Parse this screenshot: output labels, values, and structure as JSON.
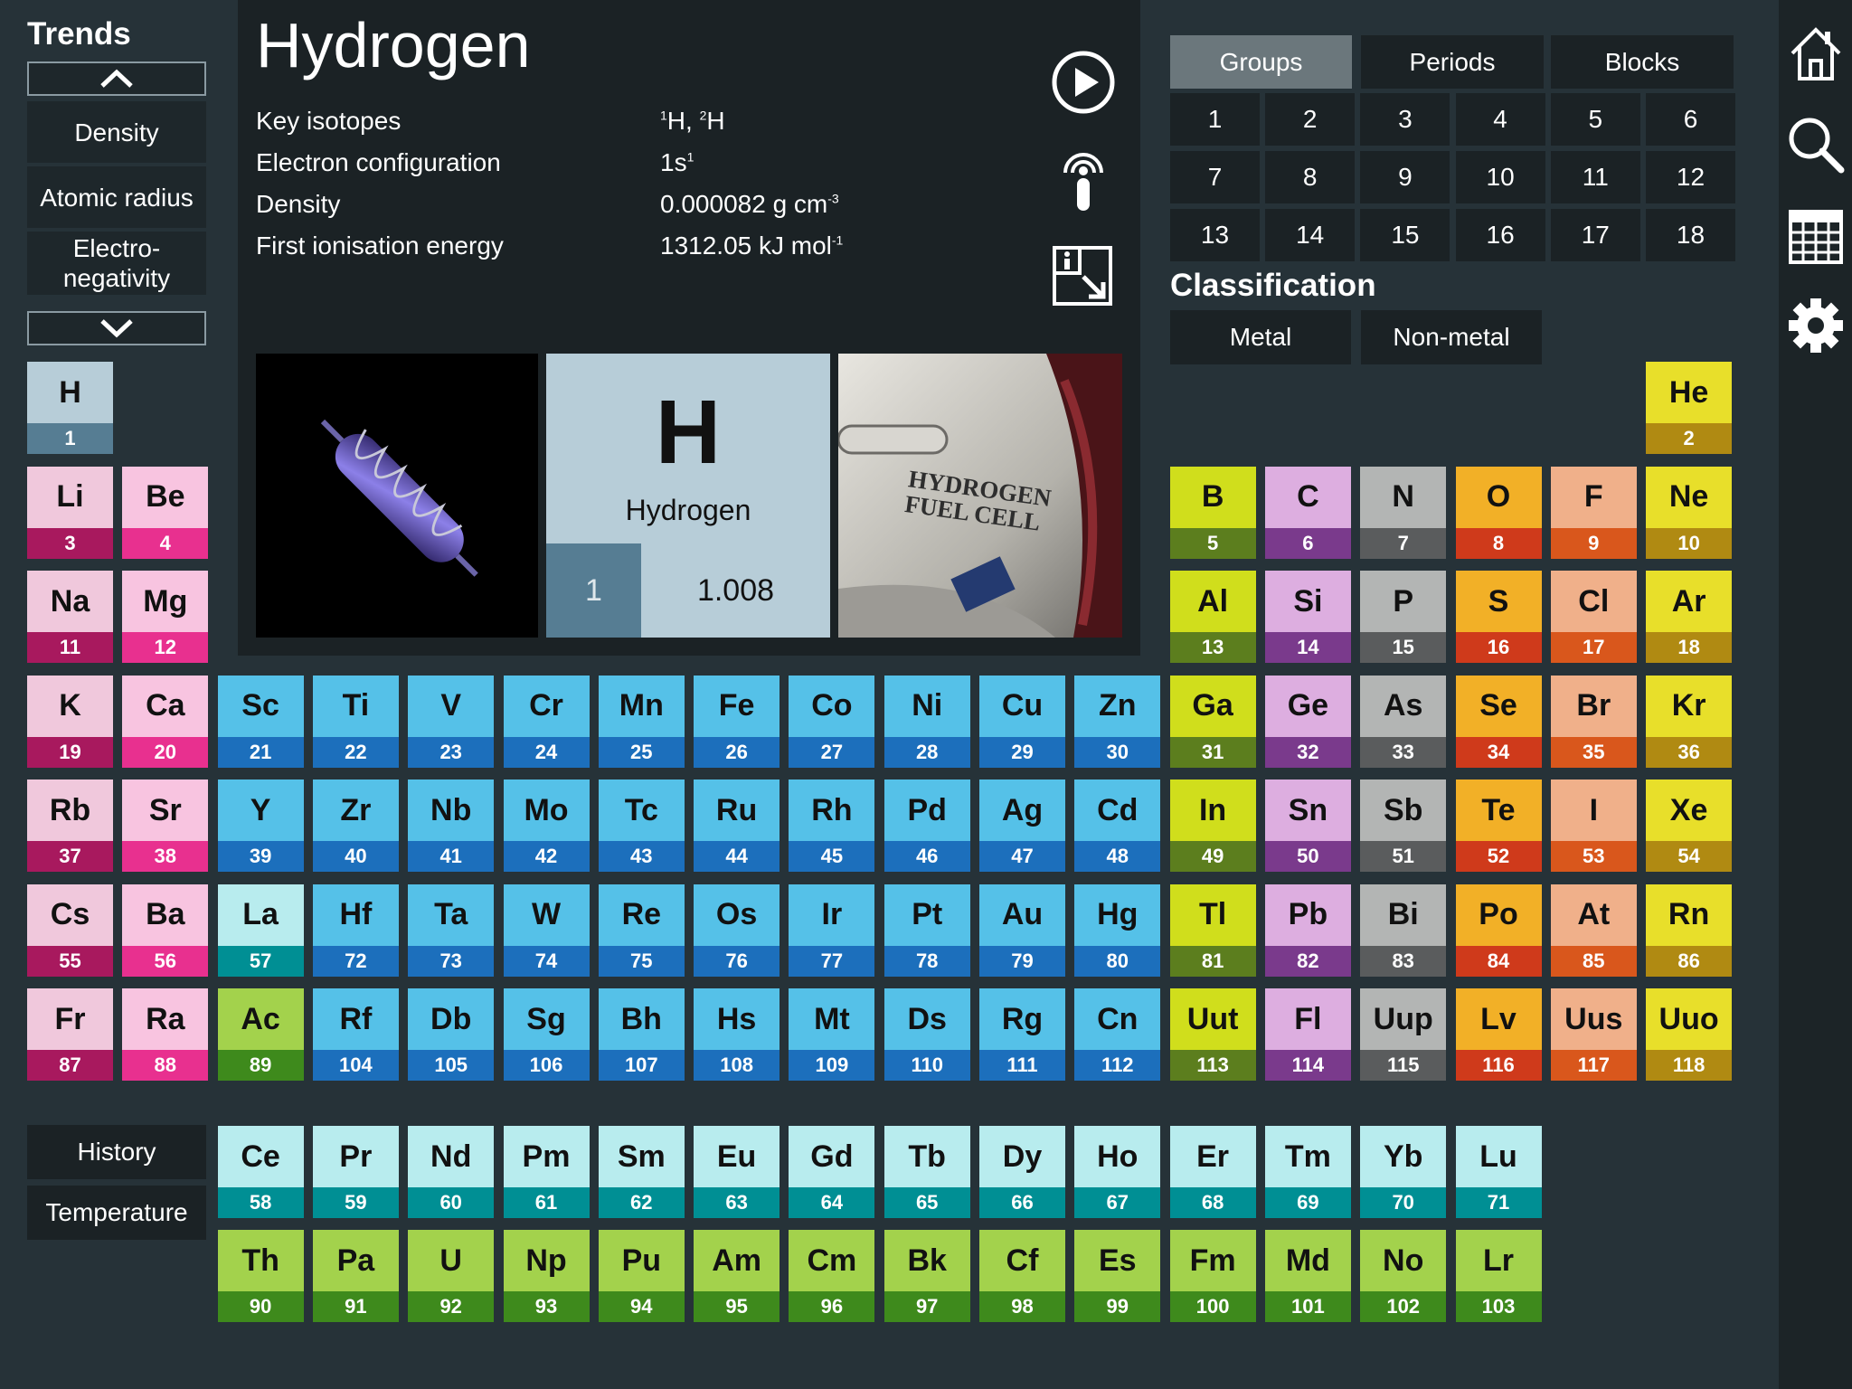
{
  "trends": {
    "title": "Trends",
    "items": [
      "Density",
      "Atomic radius",
      "Electro-\nnegativity"
    ]
  },
  "element": {
    "name": "Hydrogen",
    "symbol": "H",
    "number": "1",
    "mass": "1.008",
    "properties": [
      {
        "label": "Key isotopes",
        "value": [
          {
            "t": "1",
            "sup": true
          },
          {
            "t": "H, "
          },
          {
            "t": "2",
            "sup": true
          },
          {
            "t": "H"
          }
        ]
      },
      {
        "label": "Electron configuration",
        "value": [
          {
            "t": "1s"
          },
          {
            "t": "1",
            "sup": true
          }
        ]
      },
      {
        "label": "Density",
        "value": [
          {
            "t": "0.000082 g cm"
          },
          {
            "t": "-3",
            "sup": true
          }
        ]
      },
      {
        "label": "First ionisation energy",
        "value": [
          {
            "t": "1312.05 kJ mol"
          },
          {
            "t": "-1",
            "sup": true
          }
        ]
      }
    ],
    "photo_label": "HYDROGEN\nFUEL CELL"
  },
  "filters": {
    "tabs": [
      "Groups",
      "Periods",
      "Blocks"
    ],
    "active_tab": "Groups",
    "groups": [
      "1",
      "2",
      "3",
      "4",
      "5",
      "6",
      "7",
      "8",
      "9",
      "10",
      "11",
      "12",
      "13",
      "14",
      "15",
      "16",
      "17",
      "18"
    ],
    "classification_title": "Classification",
    "classification": [
      "Metal",
      "Non-metal"
    ]
  },
  "bottom_buttons": [
    "History",
    "Temperature"
  ],
  "sidebar_icons": [
    "home-icon",
    "search-icon",
    "table-icon",
    "gear-icon"
  ],
  "colors": {
    "alkali": {
      "top": "#f0c8dc",
      "bot": "#a8195e"
    },
    "alkaline": {
      "top": "#f8c4e0",
      "bot": "#e8308f"
    },
    "hydrogen": {
      "top": "#b7cdd8",
      "bot": "#567d93"
    },
    "transition": {
      "top": "#55c1e8",
      "bot": "#1c6fbc"
    },
    "lanthanide": {
      "top": "#b8ecee",
      "bot": "#008f94"
    },
    "actinide": {
      "top": "#a3d24c",
      "bot": "#3e8a1c"
    },
    "post": {
      "top": "#d0de1c",
      "bot": "#5c7e1e"
    },
    "metalloid": {
      "top": "#ddaee0",
      "bot": "#7a3a8c"
    },
    "nonmetal": {
      "top": "#b3b5b4",
      "bot": "#5a5c5d"
    },
    "chalcogen": {
      "top": "#f2b027",
      "bot": "#cf3a1b"
    },
    "halogen": {
      "top": "#f0b08a",
      "bot": "#d9571c"
    },
    "noble": {
      "top": "#e8df2a",
      "bot": "#b08a12"
    }
  },
  "elements": [
    {
      "s": "H",
      "n": 1,
      "c": "hydrogen"
    },
    {
      "s": "He",
      "n": 2,
      "c": "noble"
    },
    {
      "s": "Li",
      "n": 3,
      "c": "alkali"
    },
    {
      "s": "Be",
      "n": 4,
      "c": "alkaline"
    },
    {
      "s": "B",
      "n": 5,
      "c": "post"
    },
    {
      "s": "C",
      "n": 6,
      "c": "metalloid"
    },
    {
      "s": "N",
      "n": 7,
      "c": "nonmetal"
    },
    {
      "s": "O",
      "n": 8,
      "c": "chalcogen"
    },
    {
      "s": "F",
      "n": 9,
      "c": "halogen"
    },
    {
      "s": "Ne",
      "n": 10,
      "c": "noble"
    },
    {
      "s": "Na",
      "n": 11,
      "c": "alkali"
    },
    {
      "s": "Mg",
      "n": 12,
      "c": "alkaline"
    },
    {
      "s": "Al",
      "n": 13,
      "c": "post"
    },
    {
      "s": "Si",
      "n": 14,
      "c": "metalloid"
    },
    {
      "s": "P",
      "n": 15,
      "c": "nonmetal"
    },
    {
      "s": "S",
      "n": 16,
      "c": "chalcogen"
    },
    {
      "s": "Cl",
      "n": 17,
      "c": "halogen"
    },
    {
      "s": "Ar",
      "n": 18,
      "c": "noble"
    },
    {
      "s": "K",
      "n": 19,
      "c": "alkali"
    },
    {
      "s": "Ca",
      "n": 20,
      "c": "alkaline"
    },
    {
      "s": "Sc",
      "n": 21,
      "c": "transition"
    },
    {
      "s": "Ti",
      "n": 22,
      "c": "transition"
    },
    {
      "s": "V",
      "n": 23,
      "c": "transition"
    },
    {
      "s": "Cr",
      "n": 24,
      "c": "transition"
    },
    {
      "s": "Mn",
      "n": 25,
      "c": "transition"
    },
    {
      "s": "Fe",
      "n": 26,
      "c": "transition"
    },
    {
      "s": "Co",
      "n": 27,
      "c": "transition"
    },
    {
      "s": "Ni",
      "n": 28,
      "c": "transition"
    },
    {
      "s": "Cu",
      "n": 29,
      "c": "transition"
    },
    {
      "s": "Zn",
      "n": 30,
      "c": "transition"
    },
    {
      "s": "Ga",
      "n": 31,
      "c": "post"
    },
    {
      "s": "Ge",
      "n": 32,
      "c": "metalloid"
    },
    {
      "s": "As",
      "n": 33,
      "c": "nonmetal"
    },
    {
      "s": "Se",
      "n": 34,
      "c": "chalcogen"
    },
    {
      "s": "Br",
      "n": 35,
      "c": "halogen"
    },
    {
      "s": "Kr",
      "n": 36,
      "c": "noble"
    },
    {
      "s": "Rb",
      "n": 37,
      "c": "alkali"
    },
    {
      "s": "Sr",
      "n": 38,
      "c": "alkaline"
    },
    {
      "s": "Y",
      "n": 39,
      "c": "transition"
    },
    {
      "s": "Zr",
      "n": 40,
      "c": "transition"
    },
    {
      "s": "Nb",
      "n": 41,
      "c": "transition"
    },
    {
      "s": "Mo",
      "n": 42,
      "c": "transition"
    },
    {
      "s": "Tc",
      "n": 43,
      "c": "transition"
    },
    {
      "s": "Ru",
      "n": 44,
      "c": "transition"
    },
    {
      "s": "Rh",
      "n": 45,
      "c": "transition"
    },
    {
      "s": "Pd",
      "n": 46,
      "c": "transition"
    },
    {
      "s": "Ag",
      "n": 47,
      "c": "transition"
    },
    {
      "s": "Cd",
      "n": 48,
      "c": "transition"
    },
    {
      "s": "In",
      "n": 49,
      "c": "post"
    },
    {
      "s": "Sn",
      "n": 50,
      "c": "metalloid"
    },
    {
      "s": "Sb",
      "n": 51,
      "c": "nonmetal"
    },
    {
      "s": "Te",
      "n": 52,
      "c": "chalcogen"
    },
    {
      "s": "I",
      "n": 53,
      "c": "halogen"
    },
    {
      "s": "Xe",
      "n": 54,
      "c": "noble"
    },
    {
      "s": "Cs",
      "n": 55,
      "c": "alkali"
    },
    {
      "s": "Ba",
      "n": 56,
      "c": "alkaline"
    },
    {
      "s": "La",
      "n": 57,
      "c": "lanthanide"
    },
    {
      "s": "Hf",
      "n": 72,
      "c": "transition"
    },
    {
      "s": "Ta",
      "n": 73,
      "c": "transition"
    },
    {
      "s": "W",
      "n": 74,
      "c": "transition"
    },
    {
      "s": "Re",
      "n": 75,
      "c": "transition"
    },
    {
      "s": "Os",
      "n": 76,
      "c": "transition"
    },
    {
      "s": "Ir",
      "n": 77,
      "c": "transition"
    },
    {
      "s": "Pt",
      "n": 78,
      "c": "transition"
    },
    {
      "s": "Au",
      "n": 79,
      "c": "transition"
    },
    {
      "s": "Hg",
      "n": 80,
      "c": "transition"
    },
    {
      "s": "Tl",
      "n": 81,
      "c": "post"
    },
    {
      "s": "Pb",
      "n": 82,
      "c": "metalloid"
    },
    {
      "s": "Bi",
      "n": 83,
      "c": "nonmetal"
    },
    {
      "s": "Po",
      "n": 84,
      "c": "chalcogen"
    },
    {
      "s": "At",
      "n": 85,
      "c": "halogen"
    },
    {
      "s": "Rn",
      "n": 86,
      "c": "noble"
    },
    {
      "s": "Fr",
      "n": 87,
      "c": "alkali"
    },
    {
      "s": "Ra",
      "n": 88,
      "c": "alkaline"
    },
    {
      "s": "Ac",
      "n": 89,
      "c": "actinide"
    },
    {
      "s": "Rf",
      "n": 104,
      "c": "transition"
    },
    {
      "s": "Db",
      "n": 105,
      "c": "transition"
    },
    {
      "s": "Sg",
      "n": 106,
      "c": "transition"
    },
    {
      "s": "Bh",
      "n": 107,
      "c": "transition"
    },
    {
      "s": "Hs",
      "n": 108,
      "c": "transition"
    },
    {
      "s": "Mt",
      "n": 109,
      "c": "transition"
    },
    {
      "s": "Ds",
      "n": 110,
      "c": "transition"
    },
    {
      "s": "Rg",
      "n": 111,
      "c": "transition"
    },
    {
      "s": "Cn",
      "n": 112,
      "c": "transition"
    },
    {
      "s": "Uut",
      "n": 113,
      "c": "post"
    },
    {
      "s": "Fl",
      "n": 114,
      "c": "metalloid"
    },
    {
      "s": "Uup",
      "n": 115,
      "c": "nonmetal"
    },
    {
      "s": "Lv",
      "n": 116,
      "c": "chalcogen"
    },
    {
      "s": "Uus",
      "n": 117,
      "c": "halogen"
    },
    {
      "s": "Uuo",
      "n": 118,
      "c": "noble"
    }
  ],
  "lanthanides": [
    {
      "s": "Ce",
      "n": 58
    },
    {
      "s": "Pr",
      "n": 59
    },
    {
      "s": "Nd",
      "n": 60
    },
    {
      "s": "Pm",
      "n": 61
    },
    {
      "s": "Sm",
      "n": 62
    },
    {
      "s": "Eu",
      "n": 63
    },
    {
      "s": "Gd",
      "n": 64
    },
    {
      "s": "Tb",
      "n": 65
    },
    {
      "s": "Dy",
      "n": 66
    },
    {
      "s": "Ho",
      "n": 67
    },
    {
      "s": "Er",
      "n": 68
    },
    {
      "s": "Tm",
      "n": 69
    },
    {
      "s": "Yb",
      "n": 70
    },
    {
      "s": "Lu",
      "n": 71
    }
  ],
  "actinides": [
    {
      "s": "Th",
      "n": 90
    },
    {
      "s": "Pa",
      "n": 91
    },
    {
      "s": "U",
      "n": 92
    },
    {
      "s": "Np",
      "n": 93
    },
    {
      "s": "Pu",
      "n": 94
    },
    {
      "s": "Am",
      "n": 95
    },
    {
      "s": "Cm",
      "n": 96
    },
    {
      "s": "Bk",
      "n": 97
    },
    {
      "s": "Cf",
      "n": 98
    },
    {
      "s": "Es",
      "n": 99
    },
    {
      "s": "Fm",
      "n": 100
    },
    {
      "s": "Md",
      "n": 101
    },
    {
      "s": "No",
      "n": 102
    },
    {
      "s": "Lr",
      "n": 103
    }
  ]
}
